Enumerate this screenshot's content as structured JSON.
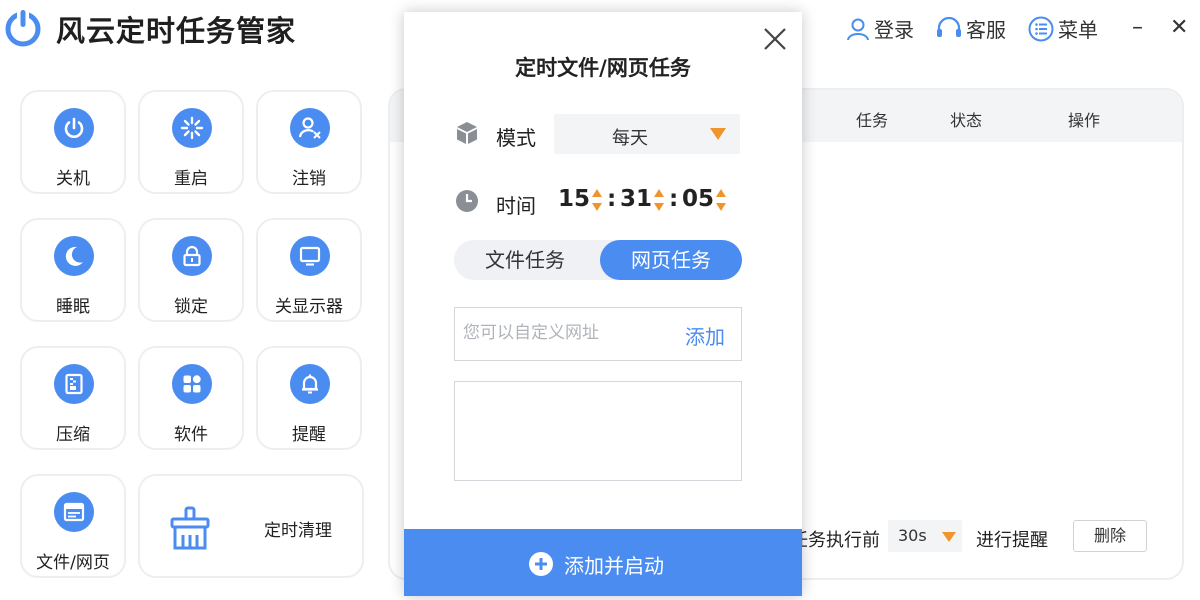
{
  "app": {
    "title": "风云定时任务管家"
  },
  "header": {
    "login_label": "登录",
    "service_label": "客服",
    "menu_label": "菜单",
    "minimize_glyph": "–",
    "close_glyph": "✕"
  },
  "tools": [
    {
      "label": "关机",
      "icon": "power-icon"
    },
    {
      "label": "重启",
      "icon": "restart-icon"
    },
    {
      "label": "注销",
      "icon": "logout-user-icon"
    },
    {
      "label": "睡眠",
      "icon": "moon-icon"
    },
    {
      "label": "锁定",
      "icon": "lock-icon"
    },
    {
      "label": "关显示器",
      "icon": "monitor-icon"
    },
    {
      "label": "压缩",
      "icon": "zip-icon"
    },
    {
      "label": "软件",
      "icon": "apps-icon"
    },
    {
      "label": "提醒",
      "icon": "bell-icon"
    },
    {
      "label": "文件/网页",
      "icon": "browser-icon"
    },
    {
      "label": "定时清理",
      "icon": "broom-icon"
    }
  ],
  "task_table": {
    "headers": [
      "任务",
      "状态",
      "操作"
    ]
  },
  "footer": {
    "prefix": "任务执行前",
    "remind_value": "30s",
    "suffix": "进行提醒",
    "delete_label": "删除"
  },
  "dialog": {
    "title": "定时文件/网页任务",
    "mode_label": "模式",
    "mode_value": "每天",
    "time_label": "时间",
    "time": {
      "hour": "15",
      "minute": "31",
      "second": "05"
    },
    "tabs": [
      {
        "label": "文件任务",
        "active": false
      },
      {
        "label": "网页任务",
        "active": true
      }
    ],
    "url_placeholder": "您可以自定义网址",
    "url_value": "",
    "add_label": "添加",
    "start_label": "添加并启动"
  },
  "colors": {
    "accent": "#4a8cf0",
    "arrow": "#f0952c"
  }
}
